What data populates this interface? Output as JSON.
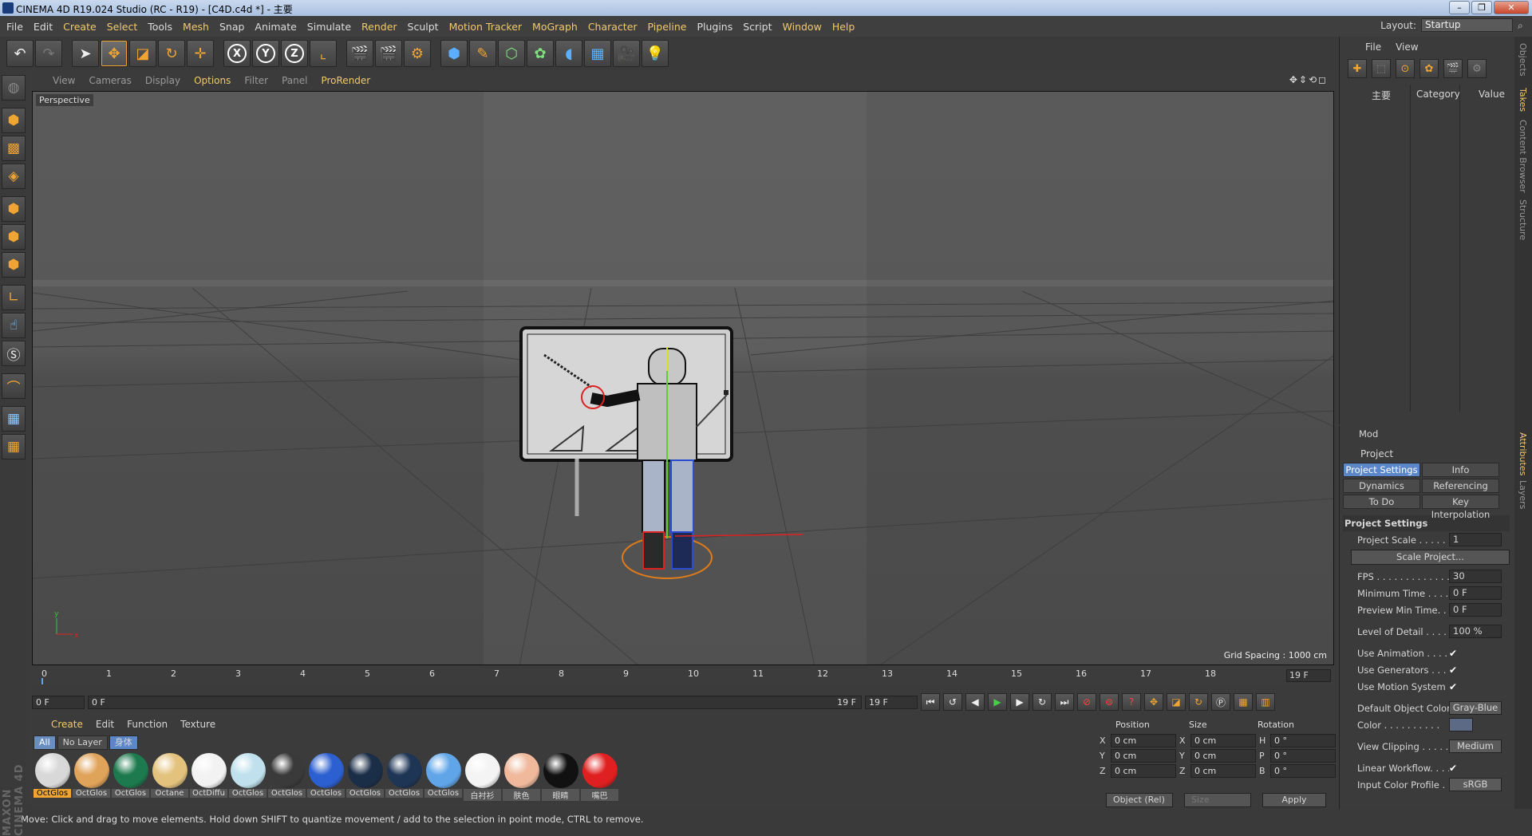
{
  "window": {
    "title": "CINEMA 4D R19.024 Studio (RC - R19) - [C4D.c4d *] - 主要"
  },
  "menubar": [
    "File",
    "Edit",
    "Create",
    "Select",
    "Tools",
    "Mesh",
    "Snap",
    "Animate",
    "Simulate",
    "Render",
    "Sculpt",
    "Motion Tracker",
    "MoGraph",
    "Character",
    "Pipeline",
    "Plugins",
    "Script",
    "Window",
    "Help"
  ],
  "layout": {
    "label": "Layout:",
    "value": "Startup"
  },
  "viewport": {
    "menu": [
      "View",
      "Cameras",
      "Display",
      "Options",
      "Filter",
      "Panel",
      "ProRender"
    ],
    "label": "Perspective",
    "grid_spacing": "Grid Spacing : 1000 cm"
  },
  "timeline": {
    "ticks": [
      "0",
      "1",
      "2",
      "3",
      "4",
      "5",
      "6",
      "7",
      "8",
      "9",
      "10",
      "11",
      "12",
      "13",
      "14",
      "15",
      "16",
      "17",
      "18"
    ],
    "end_frame": "19 F",
    "current": "0 F",
    "range_start": "0 F",
    "range_end": "19 F",
    "max": "19 F"
  },
  "materials": {
    "menu": [
      "Create",
      "Edit",
      "Function",
      "Texture"
    ],
    "tabs": [
      "All",
      "No Layer",
      "身体"
    ],
    "items": [
      {
        "label": "OctGlos",
        "color": "#d8d8d8"
      },
      {
        "label": "OctGlos",
        "color": "#e0a35a"
      },
      {
        "label": "OctGlos",
        "color": "#1d7a4e"
      },
      {
        "label": "Octane",
        "color": "#e3c27d"
      },
      {
        "label": "OctDiffu",
        "color": "#f2f2f2"
      },
      {
        "label": "OctGlos",
        "color": "#bfe0ec"
      },
      {
        "label": "OctGlos",
        "color": "#3a3a3a"
      },
      {
        "label": "OctGlos",
        "color": "#2c5fd0"
      },
      {
        "label": "OctGlos",
        "color": "#1b2e48"
      },
      {
        "label": "OctGlos",
        "color": "#1e3555"
      },
      {
        "label": "OctGlos",
        "color": "#5fa5e8"
      },
      {
        "label": "白衬衫",
        "color": "#f4f4f4"
      },
      {
        "label": "肤色",
        "color": "#f0b99c"
      },
      {
        "label": "眼睛",
        "color": "#111111"
      },
      {
        "label": "嘴巴",
        "color": "#e02020"
      }
    ]
  },
  "coords": {
    "headers": [
      "Position",
      "Size",
      "Rotation"
    ],
    "rows": [
      {
        "a": "X",
        "av": "0 cm",
        "b": "X",
        "bv": "0 cm",
        "c": "H",
        "cv": "0 °"
      },
      {
        "a": "Y",
        "av": "0 cm",
        "b": "Y",
        "bv": "0 cm",
        "c": "P",
        "cv": "0 °"
      },
      {
        "a": "Z",
        "av": "0 cm",
        "b": "Z",
        "bv": "0 cm",
        "c": "B",
        "cv": "0 °"
      }
    ],
    "mode": "Object (Rel)",
    "size_mode": "Size",
    "apply": "Apply"
  },
  "objects": {
    "menu": [
      "File",
      "View"
    ],
    "columns": {
      "name": "主要",
      "category": "Category",
      "value": "Value"
    }
  },
  "sidetabs": [
    "Objects",
    "Takes",
    "Content Browser",
    "Structure",
    "Attributes",
    "Layers"
  ],
  "attributes": {
    "menu": "Mod",
    "object": "Project",
    "tabs": [
      "Project Settings",
      "Info",
      "Dynamics",
      "Referencing",
      "To Do",
      "Key Interpolation"
    ],
    "section": "Project Settings",
    "project_scale": {
      "label": "Project Scale . . . . . . .",
      "value": "1"
    },
    "scale_button": "Scale Project...",
    "fps": {
      "label": "FPS . . . . . . . . . . . . . . .",
      "value": "30"
    },
    "min_time": {
      "label": "Minimum Time . . . . .",
      "value": "0 F"
    },
    "preview_min": {
      "label": "Preview Min Time. . .",
      "value": "0 F"
    },
    "lod": {
      "label": "Level of Detail . . . . .",
      "value": "100 %"
    },
    "use_animation": "Use Animation . . . . .",
    "use_generators": "Use Generators . . . .",
    "use_motion": "Use Motion System",
    "default_color": {
      "label": "Default Object Color",
      "value": "Gray-Blue"
    },
    "color": "Color . . . . . . . . . .",
    "view_clipping": {
      "label": "View Clipping . . . . . .",
      "value": "Medium"
    },
    "linear_workflow": "Linear Workflow. . . .",
    "input_profile": {
      "label": "Input Color Profile . .",
      "value": "sRGB"
    }
  },
  "status": "Move: Click and drag to move elements. Hold down SHIFT to quantize movement / add to the selection in point mode, CTRL to remove.",
  "brand": "MAXON CINEMA 4D"
}
